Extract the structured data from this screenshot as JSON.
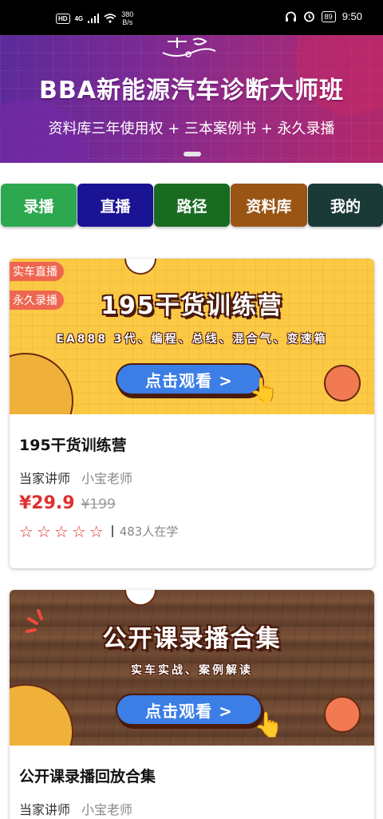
{
  "status_bar": {
    "hd_label": "HD",
    "signal_label": "4G",
    "speed_value": "380",
    "speed_unit": "B/s",
    "battery": "89",
    "time": "9:50"
  },
  "banner": {
    "title": "BBA新能源汽车诊断大师班",
    "subtitle": "资料库三年使用权 + 三本案例书 + 永久录播"
  },
  "nav": {
    "items": [
      {
        "label": "录播",
        "color": "#2ea84f"
      },
      {
        "label": "直播",
        "color": "#1a1394"
      },
      {
        "label": "路径",
        "color": "#1a6b22"
      },
      {
        "label": "资料库",
        "color": "#9a5515"
      },
      {
        "label": "我的",
        "color": "#1a3a38"
      }
    ]
  },
  "courses": [
    {
      "tags": [
        "实车直播",
        "永久录播"
      ],
      "image_title": "195干货训练营",
      "image_subtitle": "EA888 3代、编程、总线、混合气、变速箱",
      "watch_label": "点击观看 >",
      "title": "195干货训练营",
      "teacher_label": "当家讲师",
      "teacher_name": "小宝老师",
      "price": "¥29.9",
      "old_price": "¥199",
      "rating": 5,
      "students": "483人在学"
    },
    {
      "image_title": "公开课录播合集",
      "image_subtitle": "实车实战、案例解读",
      "watch_label": "点击观看 >",
      "title": "公开课录播回放合集",
      "teacher_label": "当家讲师",
      "teacher_name": "小宝老师"
    }
  ]
}
